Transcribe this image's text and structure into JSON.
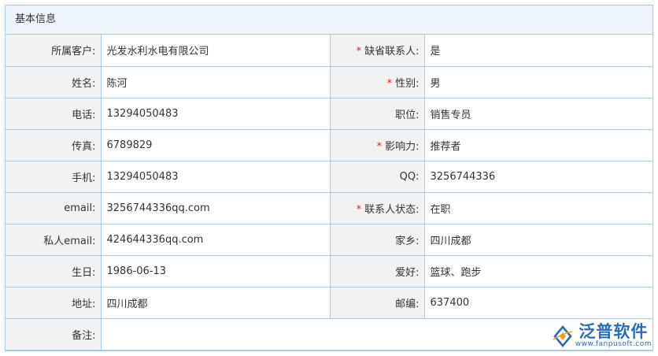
{
  "section_title": "基本信息",
  "rows": [
    {
      "l1": "所属客户:",
      "v1": "光发水利水电有限公司",
      "req2": "*",
      "l2": "缺省联系人:",
      "v2": "是"
    },
    {
      "l1": "姓名:",
      "v1": "陈河",
      "req2": "*",
      "l2": "性别:",
      "v2": "男"
    },
    {
      "l1": "电话:",
      "v1": "13294050483",
      "l2": "职位:",
      "v2": "销售专员"
    },
    {
      "l1": "传真:",
      "v1": "6789829",
      "req2": "*",
      "l2": "影响力:",
      "v2": "推荐者"
    },
    {
      "l1": "手机:",
      "v1": "13294050483",
      "l2": "QQ:",
      "v2": "3256744336"
    },
    {
      "l1": "email:",
      "v1": "3256744336qq.com",
      "req2": "*",
      "l2": "联系人状态:",
      "v2": "在职"
    },
    {
      "l1": "私人email:",
      "v1": "424644336qq.com",
      "l2": "家乡:",
      "v2": "四川成都"
    },
    {
      "l1": "生日:",
      "v1": "1986-06-13",
      "l2": "爱好:",
      "v2": "篮球、跑步"
    },
    {
      "l1": "地址:",
      "v1": "四川成都",
      "l2": "邮编:",
      "v2": "637400"
    }
  ],
  "remark": {
    "label": "备注:",
    "value": ""
  },
  "logo": {
    "name": "泛普软件",
    "url": "www.fanpusoft.com",
    "color": "#2a6db5"
  },
  "colors": {
    "border": "#a9cbe0",
    "header_bg": "#edf4fb",
    "label_bg": "#f2f2f2",
    "required": "#e02020"
  }
}
